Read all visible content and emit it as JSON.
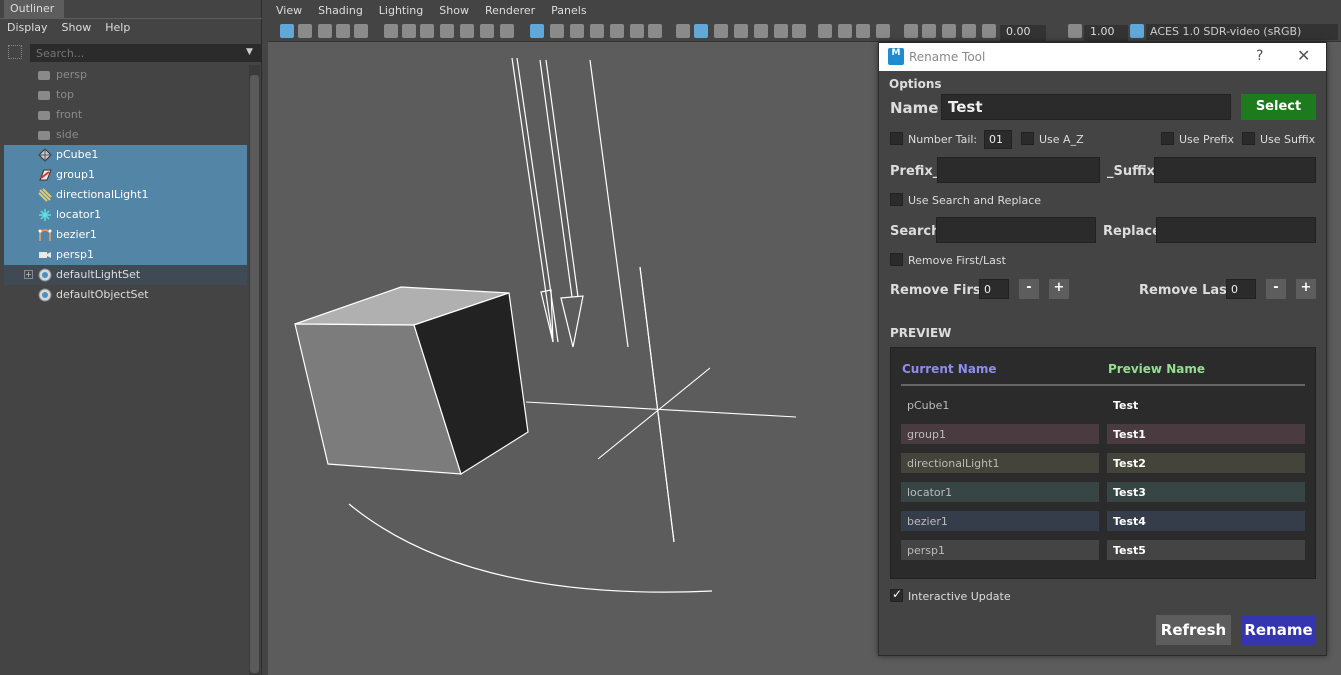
{
  "outliner": {
    "tab_label": "Outliner",
    "menu": [
      "Display",
      "Show",
      "Help"
    ],
    "search_placeholder": "Search...",
    "items": [
      {
        "label": "persp",
        "kind": "camera"
      },
      {
        "label": "top",
        "kind": "camera"
      },
      {
        "label": "front",
        "kind": "camera"
      },
      {
        "label": "side",
        "kind": "camera"
      },
      {
        "label": "pCube1",
        "kind": "mesh",
        "icon": "mesh-icon"
      },
      {
        "label": "group1",
        "kind": "group",
        "icon": "group-icon"
      },
      {
        "label": "directionalLight1",
        "kind": "light",
        "icon": "directional-light-icon"
      },
      {
        "label": "locator1",
        "kind": "locator",
        "icon": "locator-icon"
      },
      {
        "label": "bezier1",
        "kind": "curve",
        "icon": "bezier-curve-icon"
      },
      {
        "label": "persp1",
        "kind": "camera-sel",
        "icon": "camera-icon"
      },
      {
        "label": "defaultLightSet",
        "kind": "set",
        "icon": "set-icon"
      },
      {
        "label": "defaultObjectSet",
        "kind": "set",
        "icon": "set-icon"
      }
    ]
  },
  "viewport": {
    "menu": [
      "View",
      "Shading",
      "Lighting",
      "Show",
      "Renderer",
      "Panels"
    ],
    "exposure": "0.00",
    "gamma": "1.00",
    "color_space": "ACES 1.0 SDR-video (sRGB)"
  },
  "rename_tool": {
    "title": "Rename Tool",
    "help_glyph": "?",
    "close_glyph": "✕",
    "logo_text": "M",
    "options_label": "Options",
    "name_label": "Name",
    "name_value": "Test",
    "select_label": "Select",
    "number_tail_label": "Number Tail:",
    "number_tail_value": "01",
    "use_az_label": "Use A_Z",
    "use_prefix_label": "Use Prefix",
    "use_suffix_label": "Use Suffix",
    "prefix_label": "Prefix_",
    "suffix_label": "_Suffix",
    "prefix_value": "",
    "suffix_value": "",
    "use_search_replace_label": "Use Search and Replace",
    "search_label": "Search",
    "replace_label": "Replace",
    "search_value": "",
    "replace_value": "",
    "remove_first_last_label": "Remove First/Last",
    "remove_first_label": "Remove First:",
    "remove_first_value": "0",
    "remove_last_label": "Remove Last:",
    "remove_last_value": "0",
    "minus_glyph": "-",
    "plus_glyph": "+",
    "preview_label": "PREVIEW",
    "current_name_header": "Current Name",
    "preview_name_header": "Preview Name",
    "rows": [
      {
        "current": "pCube1",
        "preview": "Test",
        "color": "#2b2b2b"
      },
      {
        "current": "group1",
        "preview": "Test1",
        "color": "#4a3b40"
      },
      {
        "current": "directionalLight1",
        "preview": "Test2",
        "color": "#44443a"
      },
      {
        "current": "locator1",
        "preview": "Test3",
        "color": "#374545"
      },
      {
        "current": "bezier1",
        "preview": "Test4",
        "color": "#353d4a"
      },
      {
        "current": "persp1",
        "preview": "Test5",
        "color": "#444444"
      }
    ],
    "interactive_update_label": "Interactive Update",
    "interactive_update_checked": true,
    "refresh_label": "Refresh",
    "rename_label": "Rename",
    "colors": {
      "select": "#1d7a1d",
      "rename": "#3535b0",
      "refresh": "#5d5d5d",
      "current_header": "#8d8df0",
      "preview_header": "#90e090"
    }
  }
}
